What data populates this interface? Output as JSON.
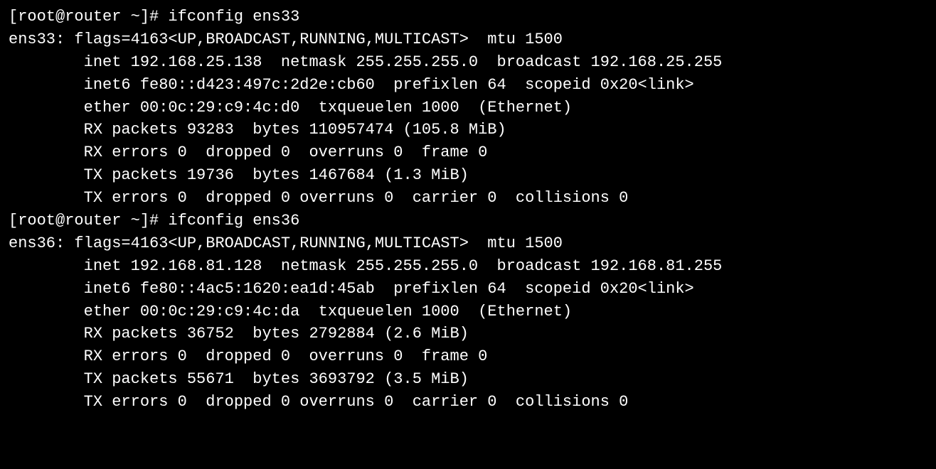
{
  "terminal": {
    "lines": [
      "[root@router ~]# ifconfig ens33",
      "ens33: flags=4163<UP,BROADCAST,RUNNING,MULTICAST>  mtu 1500",
      "        inet 192.168.25.138  netmask 255.255.255.0  broadcast 192.168.25.255",
      "        inet6 fe80::d423:497c:2d2e:cb60  prefixlen 64  scopeid 0x20<link>",
      "        ether 00:0c:29:c9:4c:d0  txqueuelen 1000  (Ethernet)",
      "        RX packets 93283  bytes 110957474 (105.8 MiB)",
      "        RX errors 0  dropped 0  overruns 0  frame 0",
      "        TX packets 19736  bytes 1467684 (1.3 MiB)",
      "        TX errors 0  dropped 0 overruns 0  carrier 0  collisions 0",
      "",
      "[root@router ~]# ifconfig ens36",
      "ens36: flags=4163<UP,BROADCAST,RUNNING,MULTICAST>  mtu 1500",
      "        inet 192.168.81.128  netmask 255.255.255.0  broadcast 192.168.81.255",
      "        inet6 fe80::4ac5:1620:ea1d:45ab  prefixlen 64  scopeid 0x20<link>",
      "        ether 00:0c:29:c9:4c:da  txqueuelen 1000  (Ethernet)",
      "        RX packets 36752  bytes 2792884 (2.6 MiB)",
      "        RX errors 0  dropped 0  overruns 0  frame 0",
      "        TX packets 55671  bytes 3693792 (3.5 MiB)",
      "        TX errors 0  dropped 0 overruns 0  carrier 0  collisions 0"
    ]
  }
}
